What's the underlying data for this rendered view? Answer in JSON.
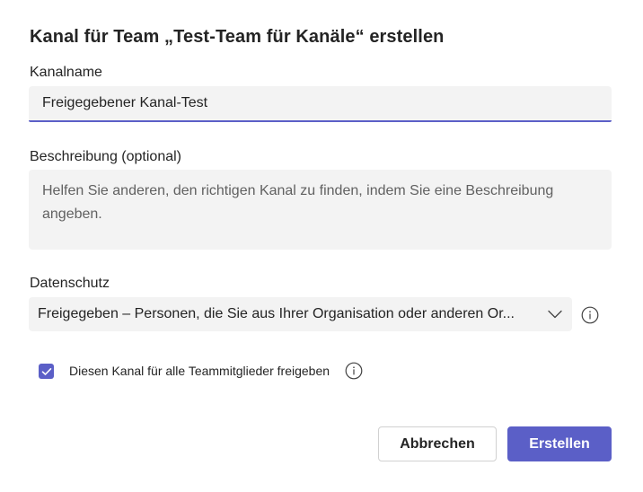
{
  "dialog": {
    "title": "Kanal für Team „Test-Team für Kanäle“ erstellen"
  },
  "channel_name": {
    "label": "Kanalname",
    "value": "Freigegebener Kanal-Test"
  },
  "description": {
    "label": "Beschreibung (optional)",
    "placeholder": "Helfen Sie anderen, den richtigen Kanal zu finden, indem Sie eine Beschreibung angeben."
  },
  "privacy": {
    "label": "Datenschutz",
    "selected": "Freigegeben – Personen, die Sie aus Ihrer Organisation oder anderen Or..."
  },
  "share_checkbox": {
    "label": "Diesen Kanal für alle Teammitglieder freigeben",
    "checked": true
  },
  "buttons": {
    "cancel": "Abbrechen",
    "create": "Erstellen"
  },
  "colors": {
    "accent": "#5b5fc7",
    "input_bg": "#f3f3f3"
  },
  "icons": [
    "chevron-down-icon",
    "info-icon",
    "checkmark-icon"
  ]
}
